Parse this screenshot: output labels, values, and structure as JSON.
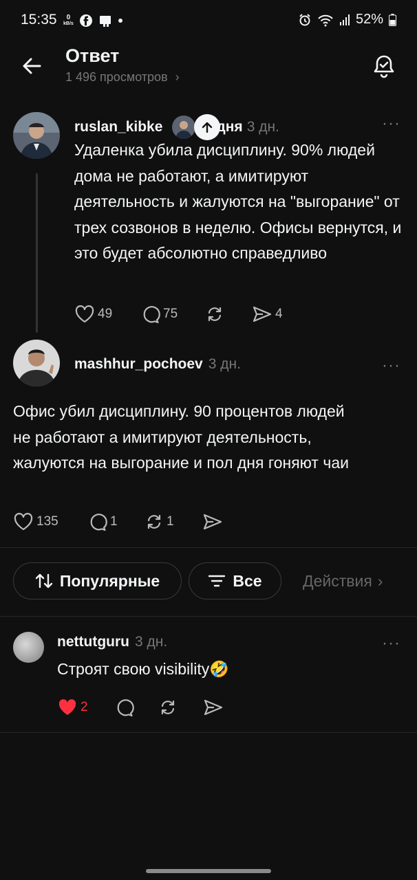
{
  "status_bar": {
    "time": "15:35",
    "net_speed_value": "0",
    "net_speed_unit": "kB/s",
    "battery": "52%"
  },
  "header": {
    "title": "Ответ",
    "views": "1 496 просмотров",
    "views_chevron": "›"
  },
  "post": {
    "username": "ruslan_kibke",
    "time_suffix": "дня",
    "time": "3 дн.",
    "text": "Удаленка убила дисциплину. 90% людей дома не работают, а имитируют деятельность и жалуются на \"выгорание\" от трех созвонов в неделю. Офисы вернутся, и это будет абсолютно справедливо",
    "likes": "49",
    "comments": "75",
    "shares": "4",
    "more": "···"
  },
  "reply": {
    "username": "mashhur_pochoev",
    "time": "3 дн.",
    "text": "Офис убил дисциплину. 90 процентов людей не работают а имитируют деятельность, жалуются на выгорание и пол дня гоняют чаи",
    "likes": "135",
    "comments": "1",
    "reposts": "1",
    "more": "···"
  },
  "filters": {
    "sort_label": "Популярные",
    "filter_label": "Все",
    "actions_label": "Действия",
    "actions_chevron": "›"
  },
  "comment": {
    "username": "nettutguru",
    "time": "3 дн.",
    "text": "Строят свою visibility🤣",
    "likes": "2",
    "more": "···"
  },
  "colors": {
    "background": "#101010",
    "text": "#f3f5f7",
    "muted": "#777777",
    "like_red": "#ff3040"
  }
}
